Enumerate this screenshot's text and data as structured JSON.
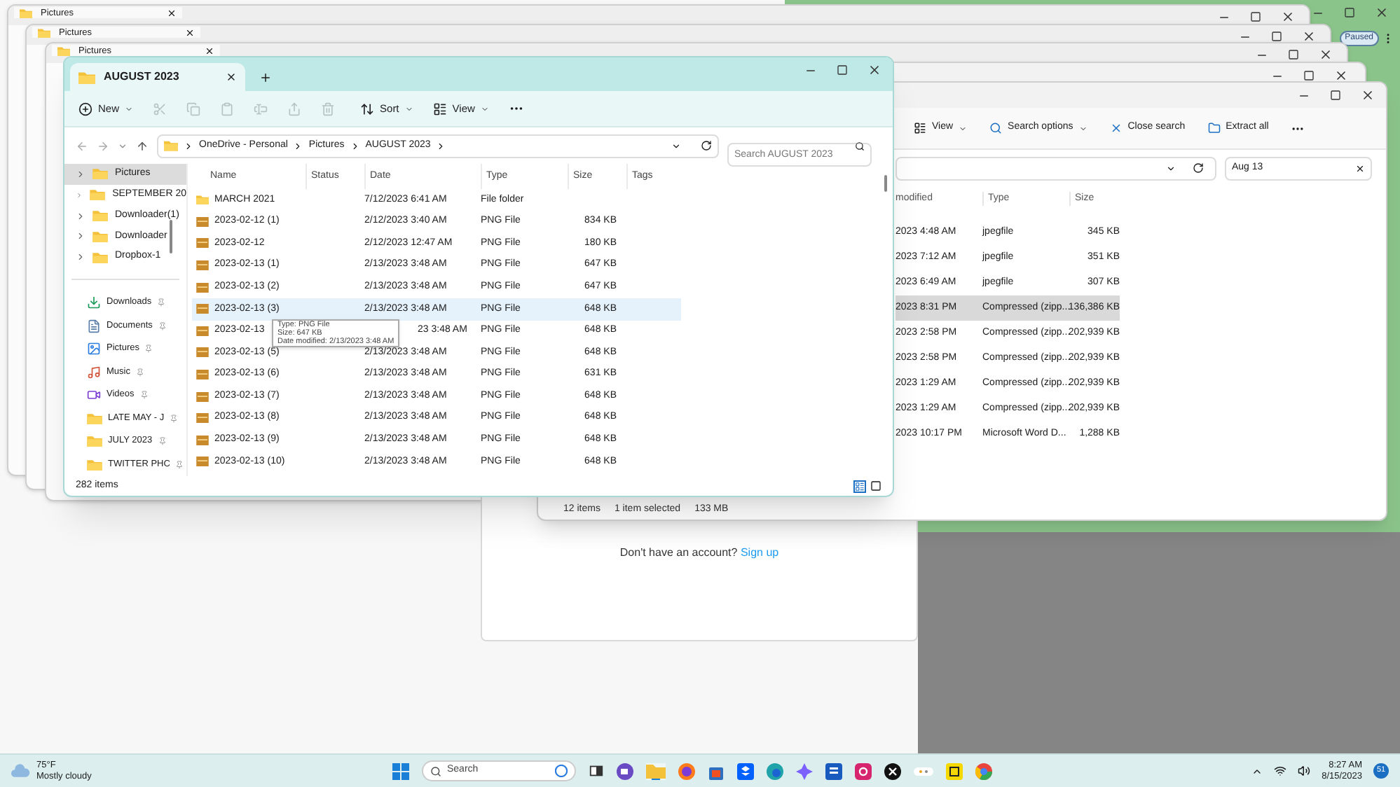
{
  "browser_window": {
    "status": "Paused"
  },
  "background_windows": [
    {
      "title": "Pictures"
    },
    {
      "title": "Pictures"
    },
    {
      "title": "Pictures"
    }
  ],
  "search_window": {
    "toolbar": [
      "View",
      "Search options",
      "Close search",
      "Extract all"
    ],
    "search_value": "Aug 13",
    "columns": [
      "modified",
      "Type",
      "Size"
    ],
    "rows": [
      {
        "modified": "2023 4:48 AM",
        "type": "jpegfile",
        "size": "345 KB",
        "selected": false
      },
      {
        "modified": "2023 7:12 AM",
        "type": "jpegfile",
        "size": "351 KB",
        "selected": false
      },
      {
        "modified": "2023 6:49 AM",
        "type": "jpegfile",
        "size": "307 KB",
        "selected": false
      },
      {
        "modified": "2023 8:31 PM",
        "type": "Compressed (zipp...",
        "size": "136,386 KB",
        "selected": true
      },
      {
        "modified": "2023 2:58 PM",
        "type": "Compressed (zipp...",
        "size": "202,939 KB",
        "selected": false
      },
      {
        "modified": "2023 2:58 PM",
        "type": "Compressed (zipp...",
        "size": "202,939 KB",
        "selected": false
      },
      {
        "modified": "2023 1:29 AM",
        "type": "Compressed (zipp...",
        "size": "202,939 KB",
        "selected": false
      },
      {
        "modified": "2023 1:29 AM",
        "type": "Compressed (zipp...",
        "size": "202,939 KB",
        "selected": false
      },
      {
        "modified": "2023 10:17 PM",
        "type": "Microsoft Word D...",
        "size": "1,288 KB",
        "selected": false
      }
    ],
    "status_bar": {
      "count": "12 items",
      "selection": "1 item selected",
      "size": "133 MB"
    }
  },
  "page": {
    "prompt": "Don't have an account?",
    "link": "Sign up"
  },
  "main_window": {
    "tab_title": "AUGUST 2023",
    "toolbar": [
      {
        "kind": "button",
        "label": "New",
        "disabled": false
      },
      {
        "kind": "icon",
        "disabled": true
      },
      {
        "kind": "icon",
        "disabled": true
      },
      {
        "kind": "icon",
        "disabled": true
      },
      {
        "kind": "icon",
        "disabled": true
      },
      {
        "kind": "icon",
        "disabled": true
      },
      {
        "kind": "icon",
        "disabled": true
      },
      {
        "kind": "button",
        "label": "Sort",
        "disabled": false
      },
      {
        "kind": "button",
        "label": "View",
        "disabled": false
      }
    ],
    "breadcrumbs": [
      "OneDrive - Personal",
      "Pictures",
      "AUGUST 2023"
    ],
    "search_placeholder": "Search AUGUST 2023",
    "sidebar": {
      "tree": [
        {
          "label": "Pictures",
          "selected": true
        },
        {
          "label": "SEPTEMBER 20",
          "selected": false
        },
        {
          "label": "Downloader(1)",
          "selected": false
        },
        {
          "label": "Downloader",
          "selected": false
        },
        {
          "label": "Dropbox-1",
          "selected": false
        }
      ],
      "quick_access": [
        {
          "label": "Downloads",
          "pinned": true
        },
        {
          "label": "Documents",
          "pinned": true
        },
        {
          "label": "Pictures",
          "pinned": true
        },
        {
          "label": "Music",
          "pinned": true
        },
        {
          "label": "Videos",
          "pinned": true
        },
        {
          "label": "LATE MAY - J",
          "pinned": true
        },
        {
          "label": "JULY 2023",
          "pinned": true
        },
        {
          "label": "TWITTER PHC",
          "pinned": true
        }
      ]
    },
    "columns": [
      "Name",
      "Status",
      "Date",
      "Type",
      "Size",
      "Tags"
    ],
    "rows": [
      {
        "kind": "folder",
        "name": "MARCH 2021",
        "date": "7/12/2023 6:41 AM",
        "type": "File folder",
        "size": "",
        "selected": false,
        "partial": false
      },
      {
        "kind": "file",
        "name": "2023-02-12 (1)",
        "date": "2/12/2023 3:40 AM",
        "type": "PNG File",
        "size": "834 KB",
        "selected": false,
        "partial": false
      },
      {
        "kind": "file",
        "name": "2023-02-12",
        "date": "2/12/2023 12:47 AM",
        "type": "PNG File",
        "size": "180 KB",
        "selected": false,
        "partial": false
      },
      {
        "kind": "file",
        "name": "2023-02-13 (1)",
        "date": "2/13/2023 3:48 AM",
        "type": "PNG File",
        "size": "647 KB",
        "selected": false,
        "partial": false
      },
      {
        "kind": "file",
        "name": "2023-02-13 (2)",
        "date": "2/13/2023 3:48 AM",
        "type": "PNG File",
        "size": "647 KB",
        "selected": false,
        "partial": false
      },
      {
        "kind": "file",
        "name": "2023-02-13 (3)",
        "date": "2/13/2023 3:48 AM",
        "type": "PNG File",
        "size": "648 KB",
        "selected": true,
        "partial": false
      },
      {
        "kind": "file",
        "name": "2023-02-13",
        "date": "23 3:48 AM",
        "type": "PNG File",
        "size": "648 KB",
        "selected": false,
        "partial": true
      },
      {
        "kind": "file",
        "name": "2023-02-13 (5)",
        "date": "2/13/2023 3:48 AM",
        "type": "PNG File",
        "size": "648 KB",
        "selected": false,
        "partial": false
      },
      {
        "kind": "file",
        "name": "2023-02-13 (6)",
        "date": "2/13/2023 3:48 AM",
        "type": "PNG File",
        "size": "631 KB",
        "selected": false,
        "partial": false
      },
      {
        "kind": "file",
        "name": "2023-02-13 (7)",
        "date": "2/13/2023 3:48 AM",
        "type": "PNG File",
        "size": "648 KB",
        "selected": false,
        "partial": false
      },
      {
        "kind": "file",
        "name": "2023-02-13 (8)",
        "date": "2/13/2023 3:48 AM",
        "type": "PNG File",
        "size": "648 KB",
        "selected": false,
        "partial": false
      },
      {
        "kind": "file",
        "name": "2023-02-13 (9)",
        "date": "2/13/2023 3:48 AM",
        "type": "PNG File",
        "size": "648 KB",
        "selected": false,
        "partial": false
      },
      {
        "kind": "file",
        "name": "2023-02-13 (10)",
        "date": "2/13/2023 3:48 AM",
        "type": "PNG File",
        "size": "648 KB",
        "selected": false,
        "partial": false
      }
    ],
    "tooltip": [
      "Type: PNG File",
      "Size: 647 KB",
      "Date modified: 2/13/2023 3:48 AM"
    ],
    "status_bar": "282 items"
  },
  "taskbar": {
    "temperature": "75°F",
    "weather": "Mostly cloudy",
    "search_placeholder": "Search",
    "time": "8:27 AM",
    "date": "8/15/2023",
    "notifications": "51"
  }
}
